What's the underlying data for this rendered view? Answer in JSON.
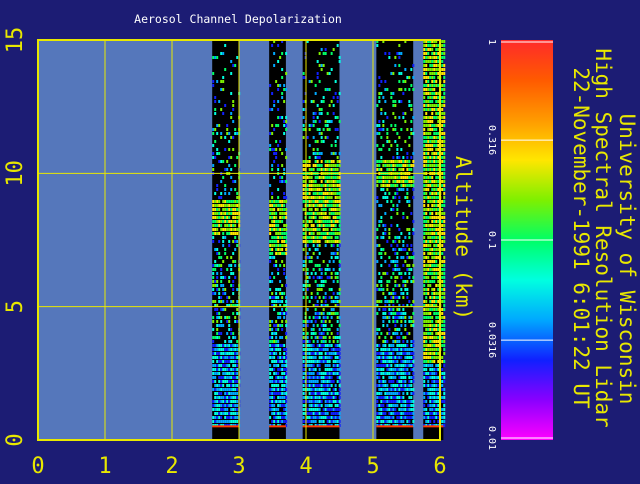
{
  "chart_data": {
    "type": "heatmap",
    "title": "Aerosol Channel Depolarization",
    "xlabel": "",
    "ylabel": "Altitude (km)",
    "xlim": [
      0,
      6
    ],
    "ylim": [
      0,
      15
    ],
    "x_ticks": [
      "0",
      "1",
      "2",
      "3",
      "4",
      "5",
      "6"
    ],
    "y_ticks": [
      "0",
      "5",
      "10",
      "15"
    ],
    "grid": true,
    "colorbar": {
      "scale": "log",
      "range": [
        0.01,
        1
      ],
      "tick_labels": [
        "1",
        "0.316",
        "0.1",
        "0.0316",
        "0.01"
      ]
    },
    "side_text": [
      "University of Wisconsin",
      "High Spectral Resolution Lidar",
      "22-November-1991   6:01:22 UT"
    ],
    "data_segments": [
      {
        "x_start": 2.6,
        "x_end": 3.0,
        "cloud_alt_km": [
          7.7,
          9.0
        ]
      },
      {
        "x_start": 3.45,
        "x_end": 3.7,
        "cloud_alt_km": [
          7.0,
          9.0
        ]
      },
      {
        "x_start": 3.95,
        "x_end": 4.5,
        "cloud_alt_km": [
          7.5,
          10.5
        ]
      },
      {
        "x_start": 5.05,
        "x_end": 5.6,
        "cloud_alt_km": [
          9.5,
          10.5
        ]
      },
      {
        "x_start": 5.75,
        "x_end": 6.05,
        "cloud_alt_km": [
          3.0,
          15.0
        ]
      }
    ]
  },
  "colors": {
    "background": "#1c1c74",
    "plot_area": "#5577bb",
    "axes": "#e8e800",
    "tick_text": "#e8e800",
    "side_text": "#e8e800",
    "title_text": "#ffffff"
  }
}
